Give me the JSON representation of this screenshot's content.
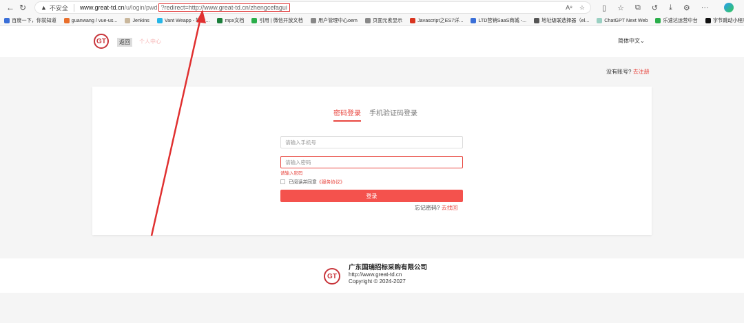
{
  "browser": {
    "insecure_label": "不安全",
    "url_host": "www.great-td.cn",
    "url_path": "/u/login/pwd",
    "url_query": "?redirect=http://www.great-td.cn/zhengcefagui",
    "reader_label": "A⁸",
    "bookmarks": [
      {
        "label": "百度一下，你就知道",
        "color": "#3a6fd8"
      },
      {
        "label": "guanwang / vue-us...",
        "color": "#e96f2b"
      },
      {
        "label": "Jenkins",
        "color": "#c9b79c"
      },
      {
        "label": "Vant Weapp - 轻量...",
        "color": "#25b6e8"
      },
      {
        "label": "mpx文档",
        "color": "#1b7e3a"
      },
      {
        "label": "引用 | 微信开放文档",
        "color": "#2aae4a"
      },
      {
        "label": "用户管理中心oem",
        "color": "#888"
      },
      {
        "label": "页面元素显示",
        "color": "#888"
      },
      {
        "label": "Javascript之ES7详...",
        "color": "#d9341f"
      },
      {
        "label": "LTD营销SaaS商城 -...",
        "color": "#3a6fd8"
      },
      {
        "label": "地址级联选择器（el...",
        "color": "#555"
      },
      {
        "label": "ChatGPT Next Web",
        "color": "#9ad0c2"
      },
      {
        "label": "乐速达运营中台",
        "color": "#2aae4a"
      },
      {
        "label": "字节跳动小程序开...",
        "color": "#111"
      }
    ]
  },
  "header": {
    "logo_text": "GT",
    "back_label": "返回",
    "user_center_label": "个人中心",
    "language_label": "简体中文"
  },
  "register_hint": {
    "prefix": "没有账号?",
    "link": "去注册"
  },
  "login": {
    "tabs": [
      {
        "label": "密码登录",
        "active": true
      },
      {
        "label": "手机验证码登录",
        "active": false
      }
    ],
    "phone_placeholder": "请输入手机号",
    "password_placeholder": "请输入密码",
    "password_error": "请输入密码",
    "agree_prefix": "已阅读并同意",
    "agree_link": "《服务协议》",
    "submit_label": "登录",
    "forgot_prefix": "忘记密码?",
    "forgot_link": "去找回"
  },
  "footer": {
    "logo_text": "GT",
    "company": "广东国瑞招标采购有限公司",
    "website": "http://www.great-td.cn",
    "copyright": "Copyright © 2024-2027"
  },
  "colors": {
    "accent": "#e8463f",
    "brand": "#c8343a",
    "annotation": "#e03030"
  }
}
